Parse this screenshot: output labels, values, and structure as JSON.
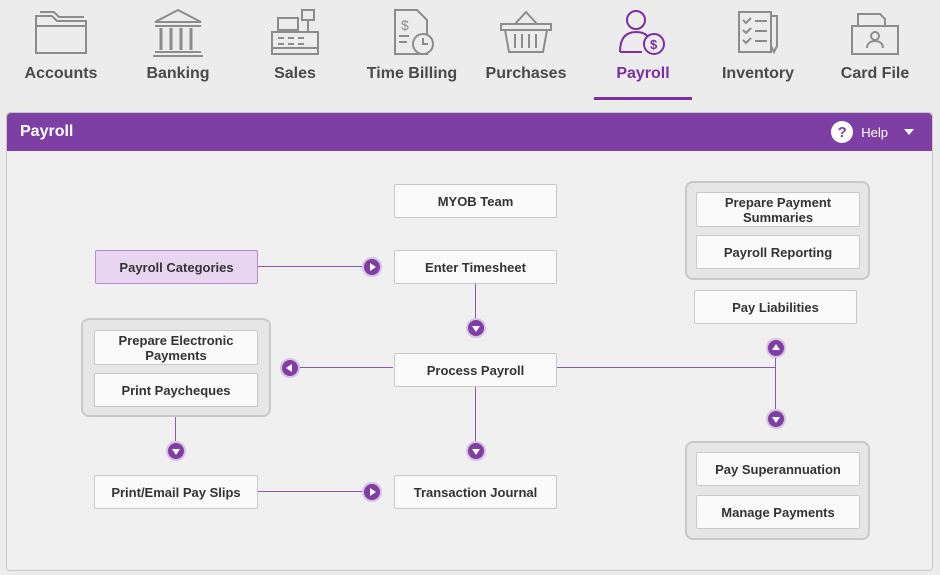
{
  "modules": [
    {
      "label": "Accounts",
      "icon": "folder-icon"
    },
    {
      "label": "Banking",
      "icon": "bank-icon"
    },
    {
      "label": "Sales",
      "icon": "cash-register-icon"
    },
    {
      "label": "Time Billing",
      "icon": "document-clock-icon"
    },
    {
      "label": "Purchases",
      "icon": "basket-icon"
    },
    {
      "label": "Payroll",
      "icon": "person-dollar-icon",
      "active": true
    },
    {
      "label": "Inventory",
      "icon": "checklist-icon"
    },
    {
      "label": "Card File",
      "icon": "card-file-icon"
    }
  ],
  "panel": {
    "title": "Payroll",
    "help_label": "Help"
  },
  "flow": {
    "myob_team": "MYOB Team",
    "enter_timesheet": "Enter Timesheet",
    "payroll_categories": "Payroll Categories",
    "process_payroll": "Process Payroll",
    "transaction_journal": "Transaction Journal",
    "prepare_electronic_payments": "Prepare Electronic Payments",
    "print_paycheques": "Print Paycheques",
    "print_email_pay_slips": "Print/Email Pay Slips",
    "prepare_payment_summaries": "Prepare Payment Summaries",
    "payroll_reporting": "Payroll Reporting",
    "pay_liabilities": "Pay Liabilities",
    "pay_superannuation": "Pay Superannuation",
    "manage_payments": "Manage Payments"
  },
  "colors": {
    "accent": "#7e3fa4",
    "active_label": "#7b2fa0",
    "selected_button": "#e8d6f0"
  }
}
